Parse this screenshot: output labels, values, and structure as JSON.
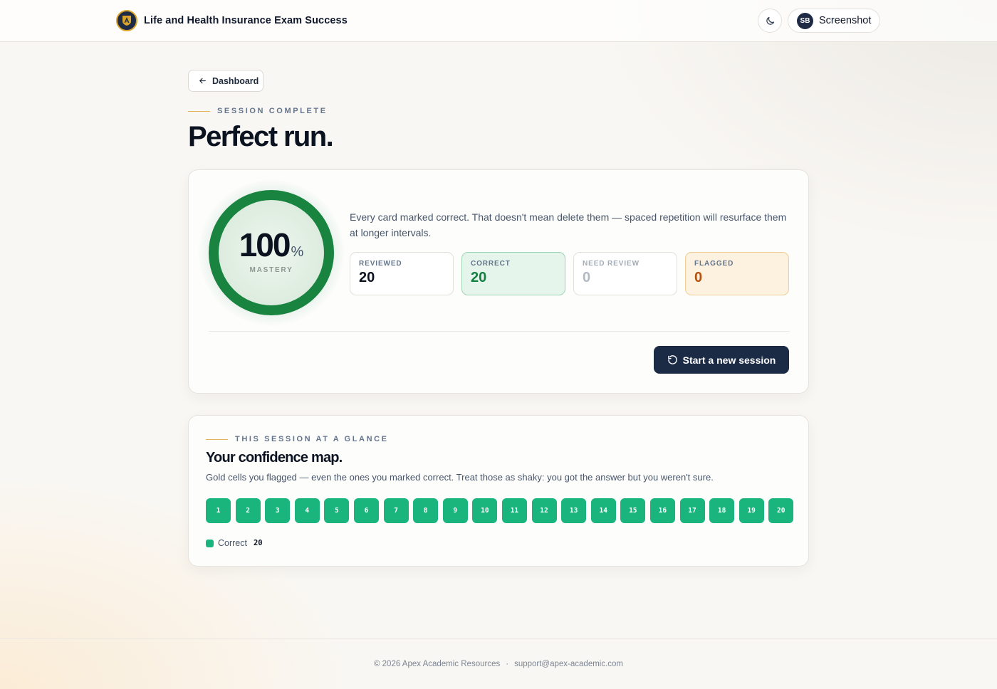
{
  "header": {
    "app_title": "Life and Health Insurance Exam Success",
    "logo_icon": "academy-shield-icon",
    "theme_icon": "moon-icon",
    "user": {
      "initials": "SB",
      "name": "Screenshot"
    }
  },
  "nav": {
    "back_label": "Dashboard",
    "back_icon": "arrow-left-icon"
  },
  "hero": {
    "eyebrow": "SESSION COMPLETE",
    "title": "Perfect run."
  },
  "summary": {
    "mastery_value": "100",
    "mastery_unit": "%",
    "mastery_fraction": 1.0,
    "mastery_label": "MASTERY",
    "message": "Every card marked correct. That doesn't mean delete them — spaced repetition will resurface them at longer intervals.",
    "stats": [
      {
        "label": "REVIEWED",
        "value": "20"
      },
      {
        "label": "CORRECT",
        "value": "20"
      },
      {
        "label": "NEED REVIEW",
        "value": "0"
      },
      {
        "label": "FLAGGED",
        "value": "0"
      }
    ],
    "cta_label": "Start a new session",
    "cta_icon": "refresh-icon"
  },
  "confidence_map": {
    "eyebrow": "THIS SESSION AT A GLANCE",
    "title": "Your confidence map.",
    "description": "Gold cells you flagged — even the ones you marked correct. Treat those as shaky: you got the answer but you weren't sure.",
    "cells": [
      "1",
      "2",
      "3",
      "4",
      "5",
      "6",
      "7",
      "8",
      "9",
      "10",
      "11",
      "12",
      "13",
      "14",
      "15",
      "16",
      "17",
      "18",
      "19",
      "20"
    ],
    "cell_color": "#19b57d",
    "legend": {
      "label": "Correct",
      "count": "20"
    }
  },
  "footer": {
    "copyright": "© 2026 Apex Academic Resources",
    "separator": "·",
    "email": "support@apex-academic.com"
  },
  "colors": {
    "accent_green": "#18843f",
    "navy": "#1b2a45",
    "gold": "#e4b25a",
    "flag_orange": "#b5520f"
  }
}
